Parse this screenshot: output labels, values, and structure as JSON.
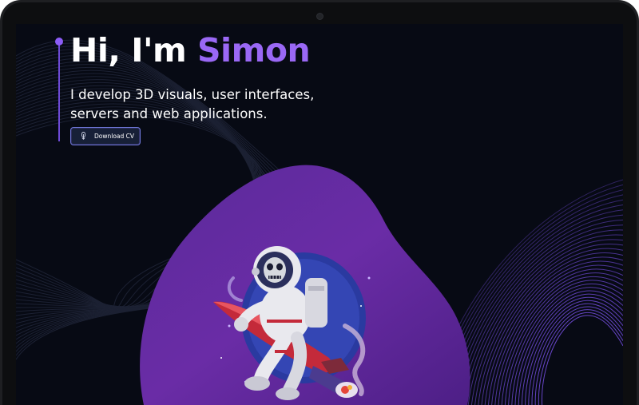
{
  "hero": {
    "greeting": "Hi, I'm",
    "name": "Simon",
    "tagline": "I develop 3D visuals, user interfaces, servers and web applications."
  },
  "download_button": {
    "label": "Download CV",
    "icon": "download-icon"
  },
  "colors": {
    "background": "#070a14",
    "accent": "#8c5cf6",
    "blob": "#6a2ca6",
    "text": "#ffffff"
  },
  "illustration": {
    "subject": "astronaut-riding-rocket"
  }
}
